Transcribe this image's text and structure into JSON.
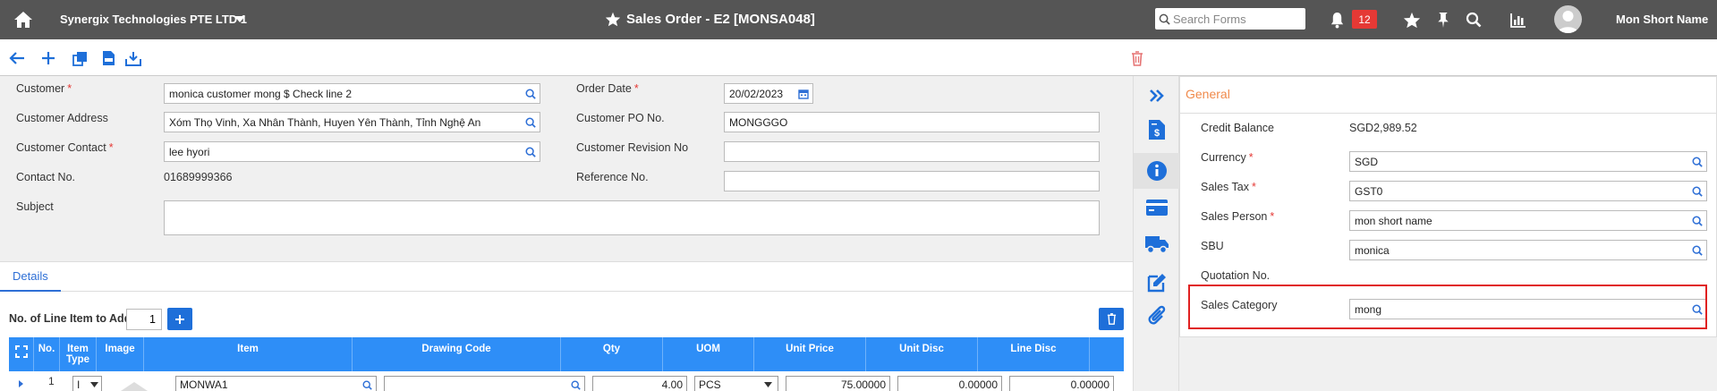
{
  "topbar": {
    "company": "Synergix Technologies PTE LTD 1",
    "title": "Sales Order - E2 [MONSA048]",
    "search_placeholder": "Search Forms",
    "notification_count": "12",
    "username": "Mon Short Name"
  },
  "form": {
    "customer": {
      "label": "Customer",
      "value": "monica customer mong $ Check line 2"
    },
    "customer_address": {
      "label": "Customer Address",
      "value": "Xóm Thọ Vinh, Xa Nhân Thành, Huyen Yên Thành, Tỉnh Nghệ An"
    },
    "customer_contact": {
      "label": "Customer Contact",
      "value": "lee hyori"
    },
    "contact_no": {
      "label": "Contact No.",
      "value": "01689999366"
    },
    "subject": {
      "label": "Subject",
      "value": ""
    },
    "order_date": {
      "label": "Order Date",
      "value": "20/02/2023"
    },
    "customer_po": {
      "label": "Customer PO No.",
      "value": "MONGGGO"
    },
    "customer_revision": {
      "label": "Customer Revision No",
      "value": ""
    },
    "reference_no": {
      "label": "Reference No.",
      "value": ""
    },
    "required_mark": "*"
  },
  "details": {
    "tab_label": "Details",
    "add_label": "No. of Line Item to Add",
    "add_value": "1",
    "columns": [
      "No.",
      "Item Type",
      "Image",
      "Item",
      "Drawing Code",
      "Qty",
      "UOM",
      "Unit Price",
      "Unit Disc",
      "Line Disc"
    ],
    "row": {
      "no": "1",
      "item_type": "I",
      "item": "MONWA1",
      "drawing_code": "",
      "qty": "4.00",
      "uom": "PCS",
      "unit_price": "75.00000",
      "unit_disc": "0.00000",
      "line_disc": "0.00000"
    }
  },
  "panel": {
    "title": "General",
    "credit_balance": {
      "label": "Credit Balance",
      "value": "SGD2,989.52"
    },
    "currency": {
      "label": "Currency",
      "value": "SGD"
    },
    "sales_tax": {
      "label": "Sales Tax",
      "value": "GST0"
    },
    "sales_person": {
      "label": "Sales Person",
      "value": "mon short name"
    },
    "sbu": {
      "label": "SBU",
      "value": "monica"
    },
    "quotation_no": {
      "label": "Quotation No.",
      "value": ""
    },
    "sales_category": {
      "label": "Sales Category",
      "value": "mong"
    }
  },
  "colors": {
    "topbar": "#555555",
    "accent_blue": "#1e6fd9",
    "grid_header": "#2e8ef7",
    "panel_title": "#f08a4b",
    "required": "#e53935",
    "highlight": "#e02020"
  }
}
